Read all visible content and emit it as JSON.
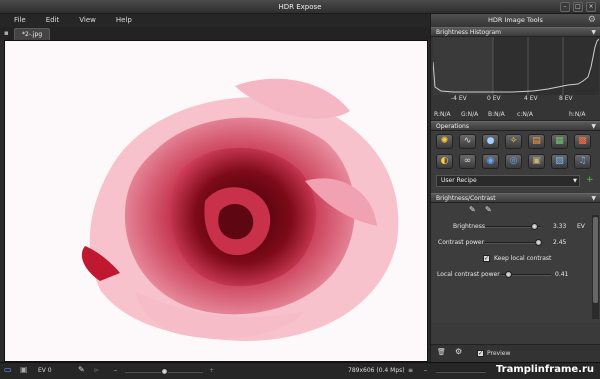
{
  "window": {
    "title": "HDR Expose"
  },
  "menu": [
    "File",
    "Edit",
    "View",
    "Help"
  ],
  "tab": {
    "label": "*2-.jpg"
  },
  "panel": {
    "title": "HDR Image Tools",
    "histogram": {
      "title": "Brightness Histogram",
      "ticks": [
        "-4 EV",
        "0 EV",
        "4 EV",
        "8 EV"
      ],
      "channels": [
        "R:N/A",
        "G:N/A",
        "B:N/A",
        "c:N/A",
        "h:N/A"
      ]
    },
    "operations": {
      "title": "Operations",
      "recipe": "User Recipe"
    },
    "brightness_contrast": {
      "title": "Brightness/Contrast",
      "brightness_label": "Brightness",
      "brightness_value": "3.33",
      "brightness_unit": "EV",
      "contrast_label": "Contrast power",
      "contrast_value": "2.45",
      "keep_local_label": "Keep local contrast",
      "local_label": "Local contrast power",
      "local_value": "0.41"
    },
    "preview_label": "Preview"
  },
  "status": {
    "ev": "EV 0",
    "dims": "789x606 (0.4 Mps)"
  },
  "watermark": "Tramplinframe.ru",
  "colors": {
    "accent_green": "#4fc34f",
    "panel_bg": "#3a3a3a"
  }
}
